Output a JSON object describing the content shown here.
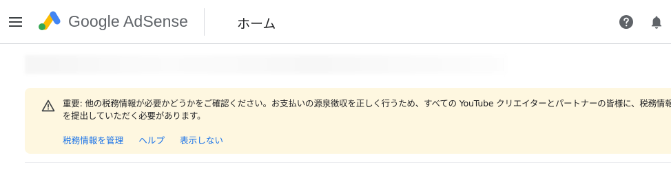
{
  "header": {
    "logo_text": "Google AdSense",
    "page_title": "ホーム"
  },
  "icons": {
    "menu": "menu-icon",
    "logo": "adsense-logo-icon",
    "help": "help-icon",
    "notifications": "bell-icon",
    "warning": "warning-icon"
  },
  "notice": {
    "message": "重要: 他の税務情報が必要かどうかをご確認ください。お支払いの源泉徴収を正しく行うため、すべての YouTube クリエイターとパートナーの皆様に、税務情報を提出していただく必要があります。",
    "actions": [
      {
        "label": "税務情報を管理"
      },
      {
        "label": "ヘルプ"
      },
      {
        "label": "表示しない"
      }
    ]
  },
  "colors": {
    "notice_background": "#fef7e0",
    "link": "#1a73e8",
    "logo_yellow": "#fbbc04",
    "logo_blue": "#4285f4",
    "logo_green": "#34a853"
  }
}
